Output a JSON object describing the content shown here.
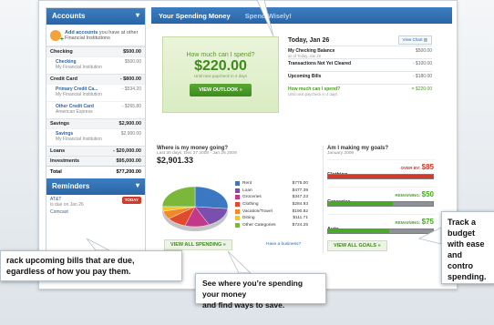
{
  "sidebar": {
    "accounts_title": "Accounts",
    "add_accounts_link": "Add accounts",
    "add_accounts_text": "you have at other Financial Institutions",
    "groups": [
      {
        "label": "Checking",
        "value": "$500.00",
        "subs": [
          {
            "name": "Checking",
            "inst": "My Financial Institution",
            "value": "$500.00"
          }
        ]
      },
      {
        "label": "Credit Card",
        "value": "- $800.00",
        "subs": [
          {
            "name": "Primary Credit Ca...",
            "inst": "My Financial Institution",
            "value": "- $534.20"
          },
          {
            "name": "Other Credit Card",
            "inst": "American Express",
            "value": "- $265.80"
          }
        ]
      },
      {
        "label": "Savings",
        "value": "$2,900.00",
        "subs": [
          {
            "name": "Savings",
            "inst": "My Financial Institution",
            "value": "$2,900.00"
          }
        ]
      },
      {
        "label": "Loans",
        "value": "- $20,000.00",
        "subs": []
      },
      {
        "label": "Investments",
        "value": "$95,000.00",
        "subs": []
      }
    ],
    "total_label": "Total",
    "total_value": "$77,200.00",
    "reminders_title": "Reminders",
    "reminder_name": "AT&T",
    "reminder_due": "is due on Jan 26",
    "reminder_badge": "TODAY",
    "reminder2_name": "Comcast"
  },
  "header": {
    "title": "Your Spending Money",
    "tagline": "Spend Wisely!"
  },
  "spend": {
    "question": "How much can I spend?",
    "amount": "$220.00",
    "until": "Until next paycheck in 4 days",
    "button": "VIEW OUTLOOK"
  },
  "today": {
    "date": "Today, Jan 26",
    "view_chart": "View Chart",
    "rows": [
      {
        "label": "My Checking Balance",
        "sub": "as of Today, Jan 26",
        "value": "$500.00"
      },
      {
        "label": "Transactions Not Yet Cleared",
        "sub": "",
        "value": "- $100.00"
      },
      {
        "label": "Upcoming Bills",
        "sub": "",
        "value": "- $180.00"
      },
      {
        "label": "How much can I spend?",
        "sub": "Until next paycheck in 4 days",
        "value": "= $220.00"
      }
    ]
  },
  "where": {
    "title": "Where is my money going?",
    "dates": "Last 30 days, Dec 27 2008 - Jan 26 2009",
    "total": "$2,901.33",
    "categories": [
      {
        "label": "Rent",
        "value": "$775.00",
        "color": "#3a78c2"
      },
      {
        "label": "Loan",
        "value": "$477.39",
        "color": "#7b4fae"
      },
      {
        "label": "Groceries",
        "value": "$347.23",
        "color": "#c2398a"
      },
      {
        "label": "Clothing",
        "value": "$284.93",
        "color": "#e24a2e"
      },
      {
        "label": "Vacation/Travel",
        "value": "$190.82",
        "color": "#f0892a"
      },
      {
        "label": "Dining",
        "value": "$111.71",
        "color": "#f4c42a"
      },
      {
        "label": "Other Categories",
        "value": "$724.25",
        "color": "#7bb83a"
      }
    ],
    "view_all": "VIEW ALL SPENDING",
    "business_link": "Have a business?"
  },
  "goals": {
    "title": "Am I making my goals?",
    "month": "January 2009",
    "items": [
      {
        "label": "Clothing",
        "status": "OVER BY:",
        "amount": "$85",
        "fill": 1.0,
        "color": "#d23a2a"
      },
      {
        "label": "Groceries",
        "status": "REMAINING:",
        "amount": "$50",
        "fill": 0.62,
        "color": "#4aa82a"
      },
      {
        "label": "Auto",
        "status": "REMAINING:",
        "amount": "$75",
        "fill": 0.58,
        "color": "#4aa82a"
      }
    ],
    "view_all": "VIEW ALL GOALS"
  },
  "callouts": {
    "track_line1": "rack upcoming bills that are due,",
    "track_line2": "egardless of how you pay them.",
    "spend_line1": "See where you’re spending your money",
    "spend_line2": "and find ways to save.",
    "budget_line1": "Track a",
    "budget_line2": "budget",
    "budget_line3": "with ease",
    "budget_line4": "and contro",
    "budget_line5": "spending."
  },
  "icons": {
    "chevron": "chevron-down-icon",
    "arrow": "double-chevron-right-icon"
  }
}
